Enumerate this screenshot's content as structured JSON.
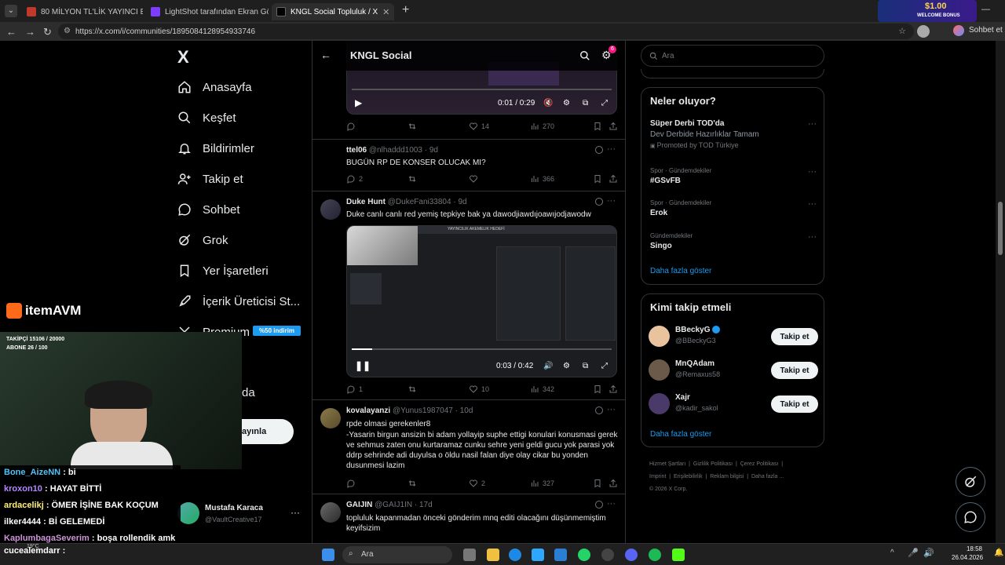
{
  "browser": {
    "tabs": [
      {
        "label": "80 MİLYON TL'LİK YAYINCI EVİM -",
        "fav": "#c0392b"
      },
      {
        "label": "LightShot tarafından Ekran Görünt",
        "fav": "#7d3cff"
      },
      {
        "label": "KNGL Social Topluluk / X",
        "fav": "#000000"
      }
    ],
    "url": "https://x.com/i/communities/1895084128954933746",
    "profile": "Sohbet et",
    "promo": "$1.00",
    "promo_sub": "WELCOME BONUS"
  },
  "nav": {
    "logo": "X",
    "items": [
      {
        "label": "Anasayfa",
        "icon": "home-icon"
      },
      {
        "label": "Keşfet",
        "icon": "search-icon"
      },
      {
        "label": "Bildirimler",
        "icon": "bell-icon"
      },
      {
        "label": "Takip et",
        "icon": "add-user-icon"
      },
      {
        "label": "Sohbet",
        "icon": "chat-icon"
      },
      {
        "label": "Grok",
        "icon": "grok-icon"
      },
      {
        "label": "Yer İşaretleri",
        "icon": "bookmark-icon"
      },
      {
        "label": "İçerik Üreticisi St...",
        "icon": "rocket-icon"
      },
      {
        "label": "Premium",
        "icon": "x-icon"
      }
    ],
    "premium_badge": "%50 indirim",
    "more_label": "da",
    "post_button": "ayınla",
    "account": {
      "name": "Mustafa Karaca",
      "handle": "@VaultCreative17"
    }
  },
  "feed": {
    "title": "KNGL Social",
    "badge": "6",
    "posts": [
      {
        "video": {
          "time": "0:01 / 0:29"
        },
        "stats": {
          "reply": "",
          "repost": "",
          "like": "14",
          "views": "270"
        }
      },
      {
        "name": "ttel06",
        "handle": "@nlhaddd1003",
        "age": "9d",
        "text": "BUGÜN RP DE KONSER OLUCAK MI?",
        "stats": {
          "reply": "2",
          "repost": "",
          "like": "",
          "views": "366"
        }
      },
      {
        "name": "Duke Hunt",
        "handle": "@DukeFani33804",
        "age": "9d",
        "text": "Duke canlı canlı red yemiş tepkiye bak ya dawodjiawdıjoawıjodjawodw",
        "video": {
          "time": "0:03 / 0:42",
          "inner_title": "YAYINCILIK AKEMELIK HEDEFİ"
        },
        "stats": {
          "reply": "1",
          "repost": "",
          "like": "10",
          "views": "342"
        }
      },
      {
        "name": "kovalayanzi",
        "handle": "@Yunus1987047",
        "age": "10d",
        "text": "rpde olmasi gerekenler8",
        "text2": "-Yasarin birgun ansizin bi adam yollayip suphe ettigi konulari konusmasi gerek ve sehmus zaten onu kurtaramaz cunku sehre yeni geldi gucu yok parasi yok ddrp sehrinde adi duyulsa o öldu nasil falan diye olay cikar bu yonden dusunmesi lazim",
        "stats": {
          "reply": "",
          "repost": "",
          "like": "2",
          "views": "327"
        }
      },
      {
        "name": "GAIJIN",
        "handle": "@GAIJ1IN",
        "age": "17d",
        "text": "topluluk kapanmadan önceki gönderim mnq editi olacağını düşünmemiştim keyifsizim"
      }
    ]
  },
  "right": {
    "search_placeholder": "Ara",
    "trends_title": "Neler oluyor?",
    "trends": [
      {
        "cat": "",
        "title": "Süper Derbi TOD'da",
        "sub": "Dev Derbide Hazırlıklar Tamam",
        "promo": "Promoted by TOD Türkiye"
      },
      {
        "cat": "Spor · Gündemdekiler",
        "title": "#GSvFB",
        "sub": "",
        "promo": ""
      },
      {
        "cat": "Spor · Gündemdekiler",
        "title": "Erok",
        "sub": "",
        "promo": ""
      },
      {
        "cat": "Gündemdekiler",
        "title": "Singo",
        "sub": "",
        "promo": ""
      }
    ],
    "show_more": "Daha fazla göster",
    "follow_title": "Kimi takip etmeli",
    "follow": [
      {
        "name": "BBeckyG",
        "handle": "@BBeckyG3",
        "color": "#e8c39e"
      },
      {
        "name": "MnQAdam",
        "handle": "@Remaxus58",
        "color": "#6b5a4a"
      },
      {
        "name": "Xajr",
        "handle": "@kadir_sakol",
        "color": "#4a3a6a"
      }
    ],
    "follow_button": "Takip et",
    "footer": [
      "Hizmet Şartları",
      "Gizlilik Politikası",
      "Çerez Politikası",
      "Imprint",
      "Erişilebilirlik",
      "Reklam bilgisi",
      "Daha fazla ...",
      "© 2026 X Corp."
    ]
  },
  "stream": {
    "brand": "itemAVM",
    "followers": "TAKİPÇİ 15106 / 20000",
    "subs": "ABONE 26 / 100",
    "chat": [
      {
        "user": "Bone_AizeNN",
        "msg": ": bi",
        "color": "#4fc3f7"
      },
      {
        "user": "kroxon10",
        "msg": ": HAYAT BİTTİ",
        "color": "#b388ff"
      },
      {
        "user": "ardacelikj",
        "msg": ": ÖMER İŞİNE BAK KOÇUM",
        "color": "#fff176"
      },
      {
        "user": "ilker4444",
        "msg": ": Bİ GELEMEDİ",
        "color": "#ffffff"
      },
      {
        "user": "KaplumbagaSeverim",
        "msg": ": boşa rollendik amk",
        "color": "#ce93d8"
      },
      {
        "user": "cucealemdarr",
        "msg": ":",
        "color": "#ffffff"
      }
    ]
  },
  "taskbar": {
    "search": "Ara",
    "time": "18:58",
    "date": "26.04.2026",
    "weather": "19°C"
  }
}
